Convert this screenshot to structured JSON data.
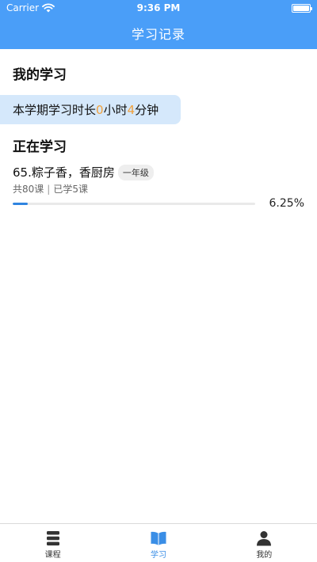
{
  "status_bar": {
    "carrier": "Carrier",
    "time": "9:36 PM"
  },
  "nav": {
    "title": "学习记录"
  },
  "my_study": {
    "title": "我的学习",
    "study_time_prefix": "本学期学习时长",
    "hours": "0",
    "hours_unit": "小时",
    "minutes": "4",
    "minutes_unit": "分钟"
  },
  "studying": {
    "title": "正在学习",
    "course": {
      "title": "65.粽子香，香厨房",
      "grade": "一年级",
      "total": "共80课",
      "learned": "已学5课",
      "progress_text": "6.25%",
      "progress": 0.0625
    }
  },
  "tabs": [
    {
      "label": "课程",
      "icon": "list-icon",
      "active": false
    },
    {
      "label": "学习",
      "icon": "book-icon",
      "active": true
    },
    {
      "label": "我的",
      "icon": "person-icon",
      "active": false
    }
  ],
  "colors": {
    "brand": "#4a9ef8",
    "accent_number": "#f0a03c",
    "progress": "#2f84e0",
    "active_tab": "#3a8ee6"
  }
}
